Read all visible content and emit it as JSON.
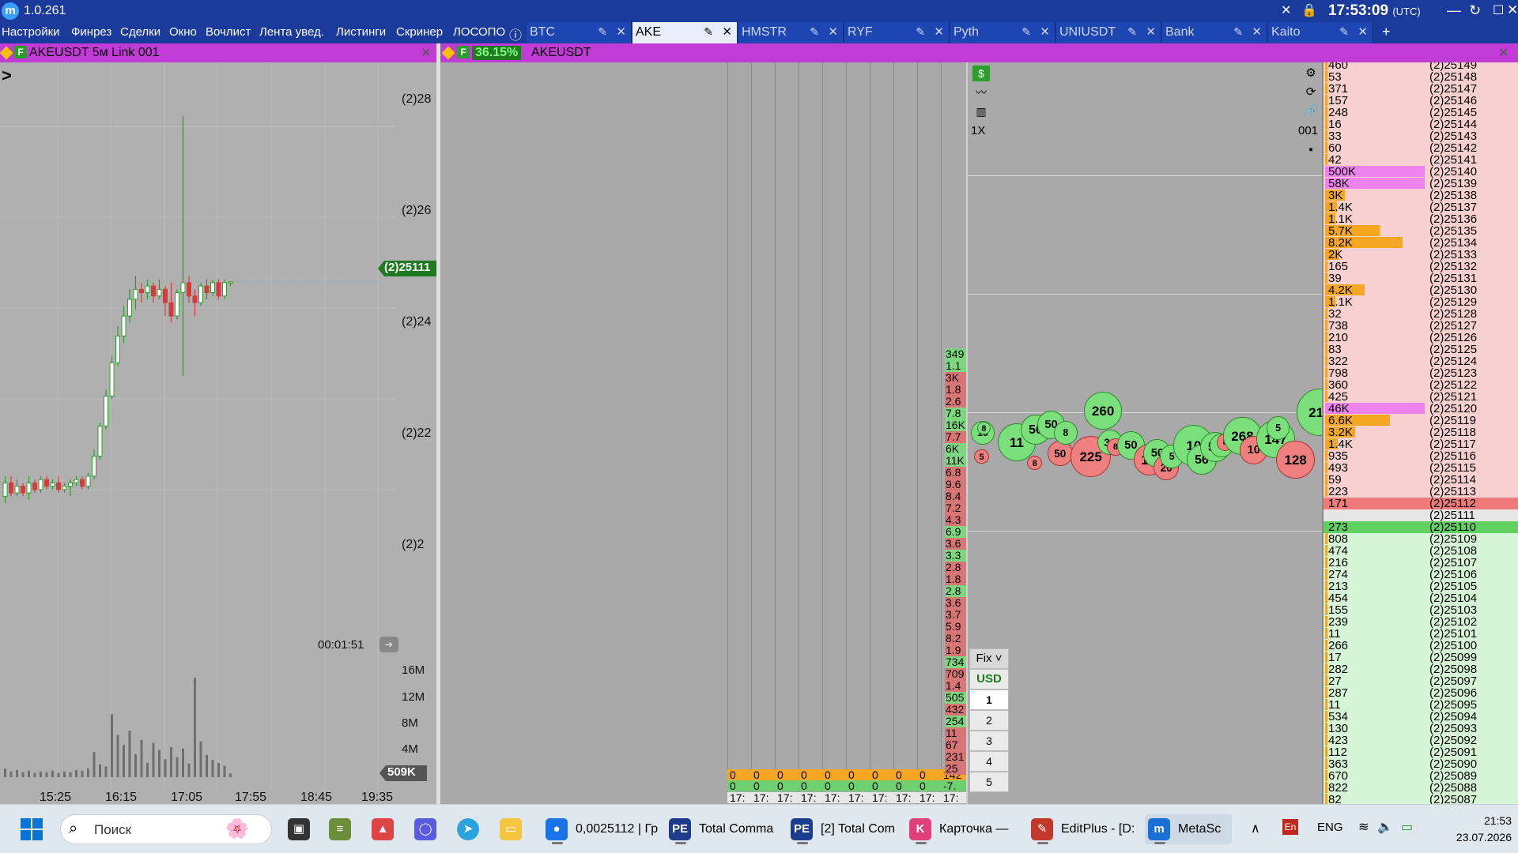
{
  "app": {
    "version": "1.0.261",
    "logo": "m"
  },
  "clock": {
    "time": "17:53:09",
    "tz": "(UTC)"
  },
  "menu": [
    "Настройки",
    "Финрез",
    "Сделки",
    "Окно",
    "Вочлист",
    "Лента увед.",
    "Листинги",
    "Скринер",
    "ЛОСОПО"
  ],
  "tabs": [
    {
      "label": "BTC",
      "active": false
    },
    {
      "label": "AKE",
      "active": true
    },
    {
      "label": "HMSTR",
      "active": false
    },
    {
      "label": "RYF",
      "active": false
    },
    {
      "label": "Pyth",
      "active": false
    },
    {
      "label": "UNIUSDT",
      "active": false
    },
    {
      "label": "Bank",
      "active": false
    },
    {
      "label": "Kaito",
      "active": false
    }
  ],
  "tab_add": "+",
  "left_panel": {
    "title": "AKEUSDT 5м Link 001",
    "f_badge": "F",
    "price_ticks": [
      "(2)28",
      "(2)26",
      "(2)24",
      "(2)22",
      "(2)2"
    ],
    "last_price": "(2)25111",
    "timer": "00:01:51",
    "volume_ticks": [
      "16M",
      "12M",
      "8M",
      "4M"
    ],
    "volume_current": "509K",
    "time_ticks": [
      "15:25",
      "16:15",
      "17:05",
      "17:55",
      "18:45",
      "19:35"
    ],
    "candles": [
      {
        "o": 21.9,
        "c": 22.1,
        "h": 22.2,
        "l": 21.8
      },
      {
        "o": 22.1,
        "c": 21.95,
        "h": 22.2,
        "l": 21.9
      },
      {
        "o": 21.95,
        "c": 22.05,
        "h": 22.15,
        "l": 21.9
      },
      {
        "o": 22.05,
        "c": 21.95,
        "h": 22.1,
        "l": 21.9
      },
      {
        "o": 21.95,
        "c": 22.1,
        "h": 22.2,
        "l": 21.85
      },
      {
        "o": 22.1,
        "c": 22.0,
        "h": 22.15,
        "l": 21.95
      },
      {
        "o": 22.0,
        "c": 22.15,
        "h": 22.2,
        "l": 21.95
      },
      {
        "o": 22.15,
        "c": 22.05,
        "h": 22.2,
        "l": 22.0
      },
      {
        "o": 22.05,
        "c": 22.1,
        "h": 22.15,
        "l": 22.0
      },
      {
        "o": 22.1,
        "c": 22.0,
        "h": 22.2,
        "l": 21.95
      },
      {
        "o": 22.0,
        "c": 22.05,
        "h": 22.1,
        "l": 21.95
      },
      {
        "o": 22.05,
        "c": 22.1,
        "h": 22.15,
        "l": 21.9
      },
      {
        "o": 22.1,
        "c": 22.15,
        "h": 22.2,
        "l": 22.05
      },
      {
        "o": 22.15,
        "c": 22.05,
        "h": 22.2,
        "l": 22.0
      },
      {
        "o": 22.05,
        "c": 22.2,
        "h": 22.25,
        "l": 22.0
      },
      {
        "o": 22.2,
        "c": 22.5,
        "h": 22.6,
        "l": 22.15
      },
      {
        "o": 22.5,
        "c": 22.95,
        "h": 23.0,
        "l": 22.45
      },
      {
        "o": 22.95,
        "c": 23.4,
        "h": 23.5,
        "l": 22.9
      },
      {
        "o": 23.4,
        "c": 23.9,
        "h": 24.0,
        "l": 23.35
      },
      {
        "o": 23.9,
        "c": 24.3,
        "h": 24.45,
        "l": 23.85
      },
      {
        "o": 24.3,
        "c": 24.6,
        "h": 24.75,
        "l": 24.2
      },
      {
        "o": 24.6,
        "c": 24.85,
        "h": 25.0,
        "l": 24.5
      },
      {
        "o": 24.85,
        "c": 25.0,
        "h": 25.2,
        "l": 24.7
      },
      {
        "o": 25.0,
        "c": 24.95,
        "h": 25.1,
        "l": 24.8
      },
      {
        "o": 24.95,
        "c": 25.05,
        "h": 25.15,
        "l": 24.85
      },
      {
        "o": 25.05,
        "c": 24.9,
        "h": 25.1,
        "l": 24.8
      },
      {
        "o": 24.9,
        "c": 25.0,
        "h": 25.15,
        "l": 24.85
      },
      {
        "o": 25.0,
        "c": 24.8,
        "h": 25.05,
        "l": 24.6
      },
      {
        "o": 24.8,
        "c": 24.6,
        "h": 25.1,
        "l": 24.5
      },
      {
        "o": 24.6,
        "c": 24.95,
        "h": 25.0,
        "l": 24.55
      },
      {
        "o": 24.95,
        "c": 25.1,
        "h": 27.6,
        "l": 23.7
      },
      {
        "o": 25.1,
        "c": 24.9,
        "h": 25.2,
        "l": 24.8
      },
      {
        "o": 24.9,
        "c": 24.8,
        "h": 25.0,
        "l": 24.6
      },
      {
        "o": 24.8,
        "c": 25.05,
        "h": 25.1,
        "l": 24.75
      },
      {
        "o": 25.05,
        "c": 24.95,
        "h": 25.15,
        "l": 24.85
      },
      {
        "o": 24.95,
        "c": 25.1,
        "h": 25.15,
        "l": 24.9
      },
      {
        "o": 25.1,
        "c": 24.9,
        "h": 25.15,
        "l": 24.85
      },
      {
        "o": 24.9,
        "c": 25.1,
        "h": 25.15,
        "l": 24.85
      },
      {
        "o": 25.1,
        "c": 25.11,
        "h": 25.12,
        "l": 25.05
      }
    ],
    "volumes": [
      1.2,
      0.8,
      1.0,
      0.7,
      0.9,
      0.6,
      0.8,
      0.7,
      0.9,
      0.6,
      0.8,
      0.7,
      1.0,
      0.9,
      1.2,
      3.5,
      1.8,
      1.5,
      8.8,
      5.9,
      4.5,
      6.5,
      3.2,
      5.2,
      2.0,
      4.8,
      3.8,
      2.5,
      4.2,
      2.8,
      4.0,
      1.9,
      13.9,
      5.0,
      3.1,
      2.4,
      2.0,
      1.6,
      0.5
    ]
  },
  "mid_panel": {
    "percent_badge": "36.15%",
    "f_badge": "F",
    "title": "AKEUSDT",
    "cluster_orange_row": [
      "0",
      "0",
      "0",
      "0",
      "0",
      "0",
      "0",
      "0",
      "0",
      "142"
    ],
    "cluster_green_row": [
      "0",
      "0",
      "0",
      "0",
      "0",
      "0",
      "0",
      "0",
      "0",
      "-7."
    ],
    "cluster_time_row": [
      "17:",
      "17:",
      "17:",
      "17:",
      "17:",
      "17:",
      "17:",
      "17:",
      "17:",
      "17:"
    ],
    "tape": [
      {
        "v": "349",
        "side": "buy"
      },
      {
        "v": "1.1",
        "side": "buy"
      },
      {
        "v": "3K",
        "side": "sell"
      },
      {
        "v": "1.8",
        "side": "sell"
      },
      {
        "v": "2.6",
        "side": "sell"
      },
      {
        "v": "7.8",
        "side": "buy"
      },
      {
        "v": "16K",
        "side": "buy"
      },
      {
        "v": "7.7",
        "side": "sell"
      },
      {
        "v": "6K",
        "side": "buy"
      },
      {
        "v": "11K",
        "side": "buy"
      },
      {
        "v": "6.8",
        "side": "sell"
      },
      {
        "v": "9.6",
        "side": "sell"
      },
      {
        "v": "8.4",
        "side": "sell"
      },
      {
        "v": "7.2",
        "side": "sell"
      },
      {
        "v": "4.3",
        "side": "sell"
      },
      {
        "v": "6.9",
        "side": "buy"
      },
      {
        "v": "3.6",
        "side": "sell"
      },
      {
        "v": "3.3",
        "side": "buy"
      },
      {
        "v": "2.8",
        "side": "sell"
      },
      {
        "v": "1.8",
        "side": "sell"
      },
      {
        "v": "2.8",
        "side": "buy"
      },
      {
        "v": "3.6",
        "side": "sell"
      },
      {
        "v": "3.7",
        "side": "sell"
      },
      {
        "v": "5.9",
        "side": "sell"
      },
      {
        "v": "8.2",
        "side": "sell"
      },
      {
        "v": "1.9",
        "side": "sell"
      },
      {
        "v": "734",
        "side": "buy"
      },
      {
        "v": "709",
        "side": "sell"
      },
      {
        "v": "1.4",
        "side": "sell"
      },
      {
        "v": "505",
        "side": "buy"
      },
      {
        "v": "432",
        "side": "sell"
      },
      {
        "v": "254",
        "side": "buy"
      },
      {
        "v": "11",
        "side": "sell"
      },
      {
        "v": "67",
        "side": "sell"
      },
      {
        "v": "231",
        "side": "sell"
      },
      {
        "v": "25",
        "side": "sell"
      }
    ]
  },
  "bubble_panel": {
    "multiplier": "1X",
    "link_id": "001",
    "order_panel": {
      "mode": "Fix",
      "currency": "USD",
      "sizes": [
        "1",
        "2",
        "3",
        "4",
        "5"
      ]
    },
    "bubbles": [
      {
        "label": "18",
        "side": "buy",
        "d": 22,
        "t": 0.0
      },
      {
        "label": "5",
        "side": "sell",
        "d": 14,
        "t": 0.01
      },
      {
        "label": "8",
        "side": "buy",
        "d": 12,
        "t": 0.02
      },
      {
        "label": "11",
        "side": "buy",
        "d": 36,
        "t": 0.08
      },
      {
        "label": "50",
        "side": "buy",
        "d": 28,
        "t": 0.15
      },
      {
        "label": "8",
        "side": "sell",
        "d": 14,
        "t": 0.17
      },
      {
        "label": "50",
        "side": "buy",
        "d": 26,
        "t": 0.2
      },
      {
        "label": "50",
        "side": "sell",
        "d": 24,
        "t": 0.23
      },
      {
        "label": "8",
        "side": "buy",
        "d": 22,
        "t": 0.25
      },
      {
        "label": "225",
        "side": "sell",
        "d": 38,
        "t": 0.3
      },
      {
        "label": "260",
        "side": "buy",
        "d": 36,
        "t": 0.34
      },
      {
        "label": "34",
        "side": "buy",
        "d": 24,
        "t": 0.38
      },
      {
        "label": "8",
        "side": "sell",
        "d": 16,
        "t": 0.41
      },
      {
        "label": "50",
        "side": "buy",
        "d": 26,
        "t": 0.44
      },
      {
        "label": "1K",
        "side": "sell",
        "d": 30,
        "t": 0.49
      },
      {
        "label": "50",
        "side": "buy",
        "d": 26,
        "t": 0.52
      },
      {
        "label": "20",
        "side": "sell",
        "d": 24,
        "t": 0.55
      },
      {
        "label": "5",
        "side": "buy",
        "d": 22,
        "t": 0.57
      },
      {
        "label": "10",
        "side": "buy",
        "d": 38,
        "t": 0.61
      },
      {
        "label": "56",
        "side": "buy",
        "d": 28,
        "t": 0.65
      },
      {
        "label": "55",
        "side": "buy",
        "d": 28,
        "t": 0.69
      },
      {
        "label": "5",
        "side": "buy",
        "d": 22,
        "t": 0.72
      },
      {
        "label": "8",
        "side": "sell",
        "d": 16,
        "t": 0.74
      },
      {
        "label": "268",
        "side": "buy",
        "d": 36,
        "t": 0.76
      },
      {
        "label": "10",
        "side": "sell",
        "d": 26,
        "t": 0.81
      },
      {
        "label": "147",
        "side": "buy",
        "d": 36,
        "t": 0.86
      },
      {
        "label": "5",
        "side": "buy",
        "d": 22,
        "t": 0.89
      },
      {
        "label": "128",
        "side": "sell",
        "d": 36,
        "t": 0.92
      },
      {
        "label": "219",
        "side": "buy",
        "d": 44,
        "t": 0.98
      }
    ]
  },
  "dom": {
    "rows": [
      {
        "vol": "460",
        "price": "(2)25149",
        "side": "ask"
      },
      {
        "vol": "53",
        "price": "(2)25148",
        "side": "ask"
      },
      {
        "vol": "371",
        "price": "(2)25147",
        "side": "ask"
      },
      {
        "vol": "157",
        "price": "(2)25146",
        "side": "ask"
      },
      {
        "vol": "248",
        "price": "(2)25145",
        "side": "ask"
      },
      {
        "vol": "16",
        "price": "(2)25144",
        "side": "ask"
      },
      {
        "vol": "33",
        "price": "(2)25143",
        "side": "ask"
      },
      {
        "vol": "60",
        "price": "(2)25142",
        "side": "ask"
      },
      {
        "vol": "42",
        "price": "(2)25141",
        "side": "ask"
      },
      {
        "vol": "500K",
        "price": "(2)25140",
        "side": "ask",
        "hl": "magenta",
        "bar": 1.0
      },
      {
        "vol": "58K",
        "price": "(2)25139",
        "side": "ask",
        "hl": "magenta",
        "bar": 1.0
      },
      {
        "vol": "3K",
        "price": "(2)25138",
        "side": "ask",
        "bar": 0.2
      },
      {
        "vol": "1.4K",
        "price": "(2)25137",
        "side": "ask",
        "bar": 0.12
      },
      {
        "vol": "1.1K",
        "price": "(2)25136",
        "side": "ask",
        "bar": 0.1
      },
      {
        "vol": "5.7K",
        "price": "(2)25135",
        "side": "ask",
        "bar": 0.55
      },
      {
        "vol": "8.2K",
        "price": "(2)25134",
        "side": "ask",
        "bar": 0.78
      },
      {
        "vol": "2K",
        "price": "(2)25133",
        "side": "ask",
        "bar": 0.14
      },
      {
        "vol": "165",
        "price": "(2)25132",
        "side": "ask"
      },
      {
        "vol": "39",
        "price": "(2)25131",
        "side": "ask"
      },
      {
        "vol": "4.2K",
        "price": "(2)25130",
        "side": "ask",
        "bar": 0.4
      },
      {
        "vol": "1.1K",
        "price": "(2)25129",
        "side": "ask",
        "bar": 0.1
      },
      {
        "vol": "32",
        "price": "(2)25128",
        "side": "ask"
      },
      {
        "vol": "738",
        "price": "(2)25127",
        "side": "ask"
      },
      {
        "vol": "210",
        "price": "(2)25126",
        "side": "ask"
      },
      {
        "vol": "83",
        "price": "(2)25125",
        "side": "ask"
      },
      {
        "vol": "322",
        "price": "(2)25124",
        "side": "ask"
      },
      {
        "vol": "798",
        "price": "(2)25123",
        "side": "ask"
      },
      {
        "vol": "360",
        "price": "(2)25122",
        "side": "ask"
      },
      {
        "vol": "425",
        "price": "(2)25121",
        "side": "ask"
      },
      {
        "vol": "46K",
        "price": "(2)25120",
        "side": "ask",
        "hl": "magenta",
        "bar": 1.0
      },
      {
        "vol": "6.6K",
        "price": "(2)25119",
        "side": "ask",
        "bar": 0.65
      },
      {
        "vol": "3.2K",
        "price": "(2)25118",
        "side": "ask",
        "bar": 0.3
      },
      {
        "vol": "1.4K",
        "price": "(2)25117",
        "side": "ask",
        "bar": 0.13
      },
      {
        "vol": "935",
        "price": "(2)25116",
        "side": "ask"
      },
      {
        "vol": "493",
        "price": "(2)25115",
        "side": "ask"
      },
      {
        "vol": "59",
        "price": "(2)25114",
        "side": "ask"
      },
      {
        "vol": "223",
        "price": "(2)25113",
        "side": "ask"
      },
      {
        "vol": "171",
        "price": "(2)25112",
        "side": "best-ask"
      },
      {
        "vol": "",
        "price": "(2)25111",
        "side": "spread"
      },
      {
        "vol": "273",
        "price": "(2)25110",
        "side": "best-bid"
      },
      {
        "vol": "808",
        "price": "(2)25109",
        "side": "bid"
      },
      {
        "vol": "474",
        "price": "(2)25108",
        "side": "bid"
      },
      {
        "vol": "216",
        "price": "(2)25107",
        "side": "bid"
      },
      {
        "vol": "274",
        "price": "(2)25106",
        "side": "bid"
      },
      {
        "vol": "213",
        "price": "(2)25105",
        "side": "bid"
      },
      {
        "vol": "454",
        "price": "(2)25104",
        "side": "bid"
      },
      {
        "vol": "155",
        "price": "(2)25103",
        "side": "bid"
      },
      {
        "vol": "239",
        "price": "(2)25102",
        "side": "bid"
      },
      {
        "vol": "11",
        "price": "(2)25101",
        "side": "bid"
      },
      {
        "vol": "266",
        "price": "(2)25100",
        "side": "bid"
      },
      {
        "vol": "17",
        "price": "(2)25099",
        "side": "bid"
      },
      {
        "vol": "282",
        "price": "(2)25098",
        "side": "bid"
      },
      {
        "vol": "27",
        "price": "(2)25097",
        "side": "bid"
      },
      {
        "vol": "287",
        "price": "(2)25096",
        "side": "bid"
      },
      {
        "vol": "11",
        "price": "(2)25095",
        "side": "bid"
      },
      {
        "vol": "534",
        "price": "(2)25094",
        "side": "bid"
      },
      {
        "vol": "130",
        "price": "(2)25093",
        "side": "bid"
      },
      {
        "vol": "423",
        "price": "(2)25092",
        "side": "bid"
      },
      {
        "vol": "112",
        "price": "(2)25091",
        "side": "bid"
      },
      {
        "vol": "363",
        "price": "(2)25090",
        "side": "bid"
      },
      {
        "vol": "670",
        "price": "(2)25089",
        "side": "bid"
      },
      {
        "vol": "822",
        "price": "(2)25088",
        "side": "bid"
      },
      {
        "vol": "82",
        "price": "(2)25087",
        "side": "bid"
      }
    ]
  },
  "taskbar": {
    "search_placeholder": "Поиск",
    "apps": [
      {
        "label": "0,0025112 | Гр",
        "icon": "chrome-icon",
        "color": "#1a73e8",
        "glyph": "●"
      },
      {
        "label": "Total Comma",
        "icon": "total-commander-icon",
        "color": "#1e3c8c",
        "glyph": "PE"
      },
      {
        "label": "[2] Total Com",
        "icon": "total-commander-icon",
        "color": "#1e3c8c",
        "glyph": "PE"
      },
      {
        "label": "Карточка —",
        "icon": "kartochka-icon",
        "color": "#e0407a",
        "glyph": "K"
      },
      {
        "label": "EditPlus - [D:",
        "icon": "editplus-icon",
        "color": "#c0392b",
        "glyph": "✎"
      },
      {
        "label": "MetaSc",
        "icon": "metascalp-icon",
        "color": "#1a6fd6",
        "glyph": "m"
      }
    ],
    "tray": {
      "lang_badge": "En",
      "lang": "ENG",
      "time": "21:53",
      "date": "23.07.2026"
    }
  },
  "colors": {
    "title_bg": "#1a3b9b",
    "panel_header": "#c13cd6",
    "ask_bg": "#f8d0d0",
    "bid_bg": "#d6f5d6",
    "up_candle": "#2aa02a",
    "down_candle": "#d23c3c",
    "orange": "#f5a623",
    "magenta": "#ee82ee"
  }
}
